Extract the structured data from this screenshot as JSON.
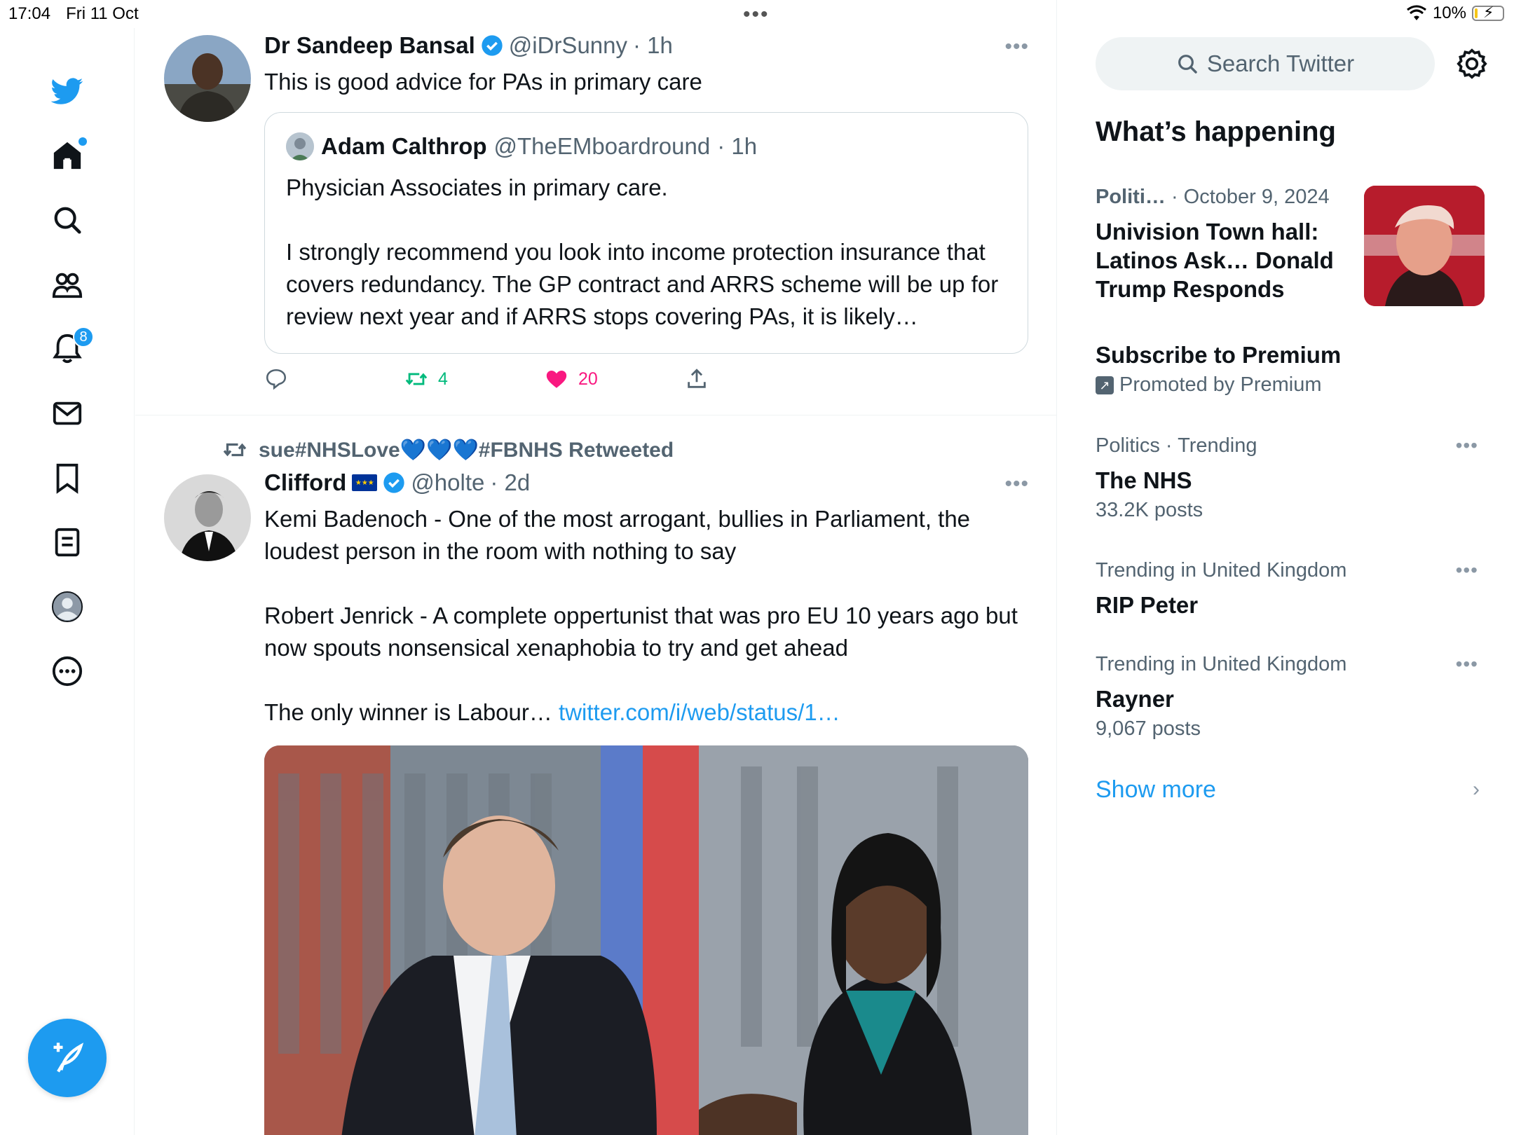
{
  "status_bar": {
    "time": "17:04",
    "date": "Fri 11 Oct",
    "battery": "10%",
    "battery_level": 0.1
  },
  "nav": {
    "notifications_count": "8"
  },
  "tweet1": {
    "name": "Dr Sandeep Bansal",
    "handle": "@iDrSunny",
    "time": "· 1h",
    "text": "This is good advice for PAs in primary care",
    "quote": {
      "name": "Adam Calthrop",
      "handle": "@TheEMboardround",
      "time": "· 1h",
      "text": "Physician Associates in primary care.\n\nI strongly recommend you look into income protection insurance that covers redundancy. The GP contract and ARRS scheme will be up for review next year and if ARRS stops covering PAs, it is likely…"
    },
    "retweets": "4",
    "likes": "20"
  },
  "tweet2": {
    "retweeted_by": "sue#NHSLove💙💙💙#FBNHS Retweeted",
    "name": "Clifford",
    "handle": "@holte",
    "time": "· 2d",
    "text": "Kemi Badenoch - One of the most arrogant, bullies in Parliament, the loudest person in the room with nothing to say\n\nRobert Jenrick - A complete oppertunist that was pro EU 10 years ago but now spouts nonsensical xenaphobia to try and get ahead\n\nThe only winner is Labour… ",
    "link": "twitter.com/i/web/status/1…"
  },
  "sidebar": {
    "search_placeholder": "Search Twitter",
    "title": "What’s happening",
    "news": {
      "category": "Politi…",
      "date": "· October 9, 2024",
      "headline": "Univision Town hall: Latinos Ask… Donald Trump Responds"
    },
    "promo": {
      "title": "Subscribe to Premium",
      "by": "Promoted by Premium"
    },
    "trends": [
      {
        "meta": "Politics · Trending",
        "title": "The NHS",
        "posts": "33.2K posts"
      },
      {
        "meta": "Trending in United Kingdom",
        "title": "RIP Peter",
        "posts": ""
      },
      {
        "meta": "Trending in United Kingdom",
        "title": "Rayner",
        "posts": "9,067 posts"
      }
    ],
    "show_more": "Show more"
  },
  "colors": {
    "accent": "#1d9bf0",
    "like": "#f91880",
    "retweet": "#00ba7c"
  }
}
